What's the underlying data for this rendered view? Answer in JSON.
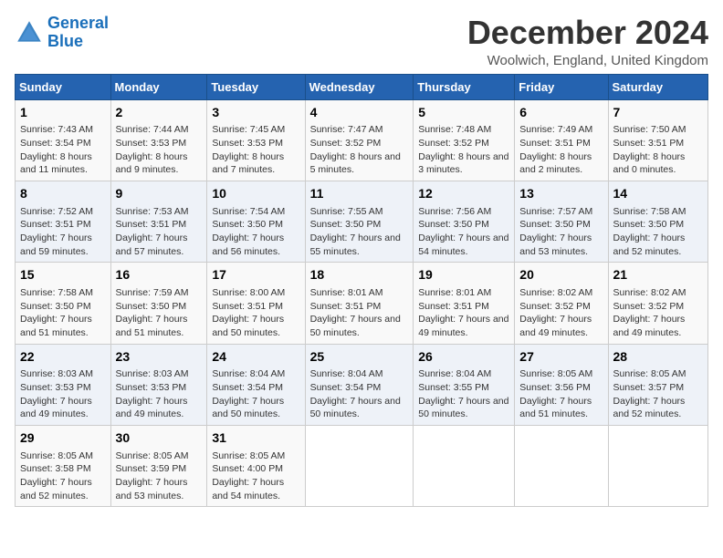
{
  "header": {
    "logo_line1": "General",
    "logo_line2": "Blue",
    "title": "December 2024",
    "subtitle": "Woolwich, England, United Kingdom"
  },
  "columns": [
    "Sunday",
    "Monday",
    "Tuesday",
    "Wednesday",
    "Thursday",
    "Friday",
    "Saturday"
  ],
  "weeks": [
    [
      {
        "day": "1",
        "sunrise": "Sunrise: 7:43 AM",
        "sunset": "Sunset: 3:54 PM",
        "daylight": "Daylight: 8 hours and 11 minutes."
      },
      {
        "day": "2",
        "sunrise": "Sunrise: 7:44 AM",
        "sunset": "Sunset: 3:53 PM",
        "daylight": "Daylight: 8 hours and 9 minutes."
      },
      {
        "day": "3",
        "sunrise": "Sunrise: 7:45 AM",
        "sunset": "Sunset: 3:53 PM",
        "daylight": "Daylight: 8 hours and 7 minutes."
      },
      {
        "day": "4",
        "sunrise": "Sunrise: 7:47 AM",
        "sunset": "Sunset: 3:52 PM",
        "daylight": "Daylight: 8 hours and 5 minutes."
      },
      {
        "day": "5",
        "sunrise": "Sunrise: 7:48 AM",
        "sunset": "Sunset: 3:52 PM",
        "daylight": "Daylight: 8 hours and 3 minutes."
      },
      {
        "day": "6",
        "sunrise": "Sunrise: 7:49 AM",
        "sunset": "Sunset: 3:51 PM",
        "daylight": "Daylight: 8 hours and 2 minutes."
      },
      {
        "day": "7",
        "sunrise": "Sunrise: 7:50 AM",
        "sunset": "Sunset: 3:51 PM",
        "daylight": "Daylight: 8 hours and 0 minutes."
      }
    ],
    [
      {
        "day": "8",
        "sunrise": "Sunrise: 7:52 AM",
        "sunset": "Sunset: 3:51 PM",
        "daylight": "Daylight: 7 hours and 59 minutes."
      },
      {
        "day": "9",
        "sunrise": "Sunrise: 7:53 AM",
        "sunset": "Sunset: 3:51 PM",
        "daylight": "Daylight: 7 hours and 57 minutes."
      },
      {
        "day": "10",
        "sunrise": "Sunrise: 7:54 AM",
        "sunset": "Sunset: 3:50 PM",
        "daylight": "Daylight: 7 hours and 56 minutes."
      },
      {
        "day": "11",
        "sunrise": "Sunrise: 7:55 AM",
        "sunset": "Sunset: 3:50 PM",
        "daylight": "Daylight: 7 hours and 55 minutes."
      },
      {
        "day": "12",
        "sunrise": "Sunrise: 7:56 AM",
        "sunset": "Sunset: 3:50 PM",
        "daylight": "Daylight: 7 hours and 54 minutes."
      },
      {
        "day": "13",
        "sunrise": "Sunrise: 7:57 AM",
        "sunset": "Sunset: 3:50 PM",
        "daylight": "Daylight: 7 hours and 53 minutes."
      },
      {
        "day": "14",
        "sunrise": "Sunrise: 7:58 AM",
        "sunset": "Sunset: 3:50 PM",
        "daylight": "Daylight: 7 hours and 52 minutes."
      }
    ],
    [
      {
        "day": "15",
        "sunrise": "Sunrise: 7:58 AM",
        "sunset": "Sunset: 3:50 PM",
        "daylight": "Daylight: 7 hours and 51 minutes."
      },
      {
        "day": "16",
        "sunrise": "Sunrise: 7:59 AM",
        "sunset": "Sunset: 3:50 PM",
        "daylight": "Daylight: 7 hours and 51 minutes."
      },
      {
        "day": "17",
        "sunrise": "Sunrise: 8:00 AM",
        "sunset": "Sunset: 3:51 PM",
        "daylight": "Daylight: 7 hours and 50 minutes."
      },
      {
        "day": "18",
        "sunrise": "Sunrise: 8:01 AM",
        "sunset": "Sunset: 3:51 PM",
        "daylight": "Daylight: 7 hours and 50 minutes."
      },
      {
        "day": "19",
        "sunrise": "Sunrise: 8:01 AM",
        "sunset": "Sunset: 3:51 PM",
        "daylight": "Daylight: 7 hours and 49 minutes."
      },
      {
        "day": "20",
        "sunrise": "Sunrise: 8:02 AM",
        "sunset": "Sunset: 3:52 PM",
        "daylight": "Daylight: 7 hours and 49 minutes."
      },
      {
        "day": "21",
        "sunrise": "Sunrise: 8:02 AM",
        "sunset": "Sunset: 3:52 PM",
        "daylight": "Daylight: 7 hours and 49 minutes."
      }
    ],
    [
      {
        "day": "22",
        "sunrise": "Sunrise: 8:03 AM",
        "sunset": "Sunset: 3:53 PM",
        "daylight": "Daylight: 7 hours and 49 minutes."
      },
      {
        "day": "23",
        "sunrise": "Sunrise: 8:03 AM",
        "sunset": "Sunset: 3:53 PM",
        "daylight": "Daylight: 7 hours and 49 minutes."
      },
      {
        "day": "24",
        "sunrise": "Sunrise: 8:04 AM",
        "sunset": "Sunset: 3:54 PM",
        "daylight": "Daylight: 7 hours and 50 minutes."
      },
      {
        "day": "25",
        "sunrise": "Sunrise: 8:04 AM",
        "sunset": "Sunset: 3:54 PM",
        "daylight": "Daylight: 7 hours and 50 minutes."
      },
      {
        "day": "26",
        "sunrise": "Sunrise: 8:04 AM",
        "sunset": "Sunset: 3:55 PM",
        "daylight": "Daylight: 7 hours and 50 minutes."
      },
      {
        "day": "27",
        "sunrise": "Sunrise: 8:05 AM",
        "sunset": "Sunset: 3:56 PM",
        "daylight": "Daylight: 7 hours and 51 minutes."
      },
      {
        "day": "28",
        "sunrise": "Sunrise: 8:05 AM",
        "sunset": "Sunset: 3:57 PM",
        "daylight": "Daylight: 7 hours and 52 minutes."
      }
    ],
    [
      {
        "day": "29",
        "sunrise": "Sunrise: 8:05 AM",
        "sunset": "Sunset: 3:58 PM",
        "daylight": "Daylight: 7 hours and 52 minutes."
      },
      {
        "day": "30",
        "sunrise": "Sunrise: 8:05 AM",
        "sunset": "Sunset: 3:59 PM",
        "daylight": "Daylight: 7 hours and 53 minutes."
      },
      {
        "day": "31",
        "sunrise": "Sunrise: 8:05 AM",
        "sunset": "Sunset: 4:00 PM",
        "daylight": "Daylight: 7 hours and 54 minutes."
      },
      null,
      null,
      null,
      null
    ]
  ]
}
